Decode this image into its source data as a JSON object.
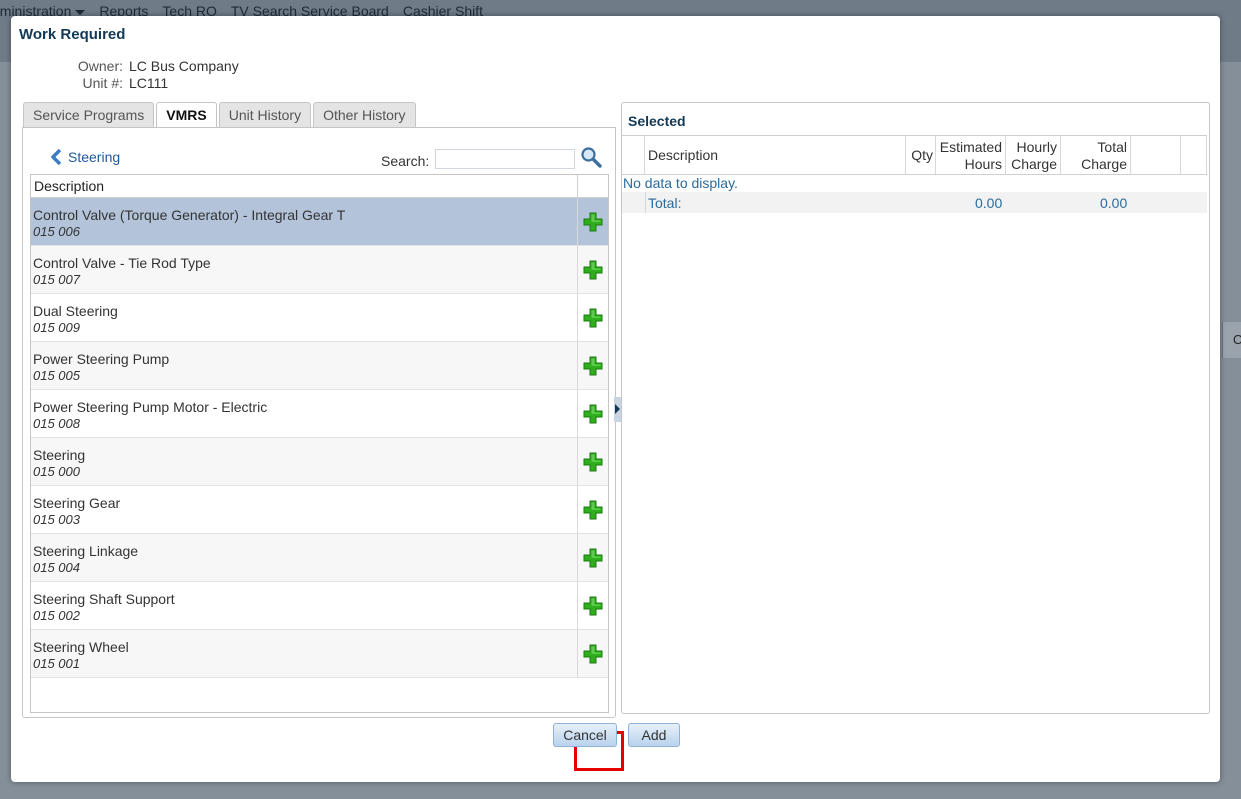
{
  "menu": {
    "items": [
      {
        "label": "dministration",
        "has_caret": true
      },
      {
        "label": "Reports"
      },
      {
        "label": "Tech RO"
      },
      {
        "label": "TV Search Service Board"
      },
      {
        "label": "Cashier Shift"
      }
    ]
  },
  "background": {
    "right_cell_text": "O"
  },
  "dialog": {
    "title": "Work Required",
    "owner_label": "Owner:",
    "owner_value": "LC Bus Company",
    "unit_label": "Unit #:",
    "unit_value": "LC111",
    "tabs": [
      "Service Programs",
      "VMRS",
      "Unit History",
      "Other History"
    ],
    "active_tab": "VMRS",
    "back_label": "Steering",
    "search_label": "Search:",
    "search_value": "",
    "list": {
      "header": "Description",
      "rows": [
        {
          "name": "Control Valve (Torque Generator) - Integral Gear T",
          "code": "015 006",
          "selected": true
        },
        {
          "name": "Control Valve - Tie Rod Type",
          "code": "015 007"
        },
        {
          "name": "Dual Steering",
          "code": "015 009"
        },
        {
          "name": "Power Steering Pump",
          "code": "015 005"
        },
        {
          "name": "Power Steering Pump Motor - Electric",
          "code": "015 008"
        },
        {
          "name": "Steering",
          "code": "015 000"
        },
        {
          "name": "Steering Gear",
          "code": "015 003"
        },
        {
          "name": "Steering Linkage",
          "code": "015 004"
        },
        {
          "name": "Steering Shaft Support",
          "code": "015 002"
        },
        {
          "name": "Steering Wheel",
          "code": "015 001"
        }
      ]
    },
    "selected": {
      "title": "Selected",
      "columns": {
        "description": "Description",
        "qty": "Qty",
        "est1": "Estimated",
        "est2": "Hours",
        "hour1": "Hourly",
        "hour2": "Charge",
        "tot1": "Total",
        "tot2": "Charge"
      },
      "no_data": "No data to display.",
      "total_label": "Total:",
      "total_hours": "0.00",
      "total_charge": "0.00"
    },
    "buttons": {
      "cancel": "Cancel",
      "add": "Add"
    }
  },
  "colors": {
    "accent": "#123a57",
    "plus": "#2fae1d",
    "highlight": "#e60000",
    "selected_row": "#b3c4da"
  }
}
